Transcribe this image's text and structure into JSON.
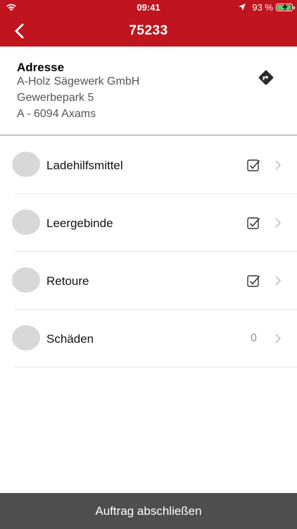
{
  "status_bar": {
    "time": "09:41",
    "battery_percent": "93 %",
    "battery_level": 0.93,
    "icons": [
      "wifi-icon",
      "location-arrow-icon",
      "battery-charging-icon"
    ]
  },
  "navbar": {
    "title": "75233",
    "back_icon": "chevron-left-icon",
    "background": "#c0141f"
  },
  "address": {
    "heading": "Adresse",
    "lines": [
      "A-Holz Sägewerk GmbH",
      "Gewerbepark 5",
      "A - 6094 Axams"
    ],
    "directions_icon": "directions-icon"
  },
  "list": {
    "items": [
      {
        "label": "Ladehilfsmittel",
        "status": "checked",
        "status_icon": "checkbox-checked-icon"
      },
      {
        "label": "Leergebinde",
        "status": "checked",
        "status_icon": "checkbox-checked-icon"
      },
      {
        "label": "Retoure",
        "status": "checked",
        "status_icon": "checkbox-checked-icon"
      },
      {
        "label": "Schäden",
        "status": "count",
        "count": "0"
      }
    ],
    "chevron_icon": "chevron-right-icon"
  },
  "footer": {
    "button_label": "Auftrag abschließen",
    "background": "#4e4e4e"
  }
}
